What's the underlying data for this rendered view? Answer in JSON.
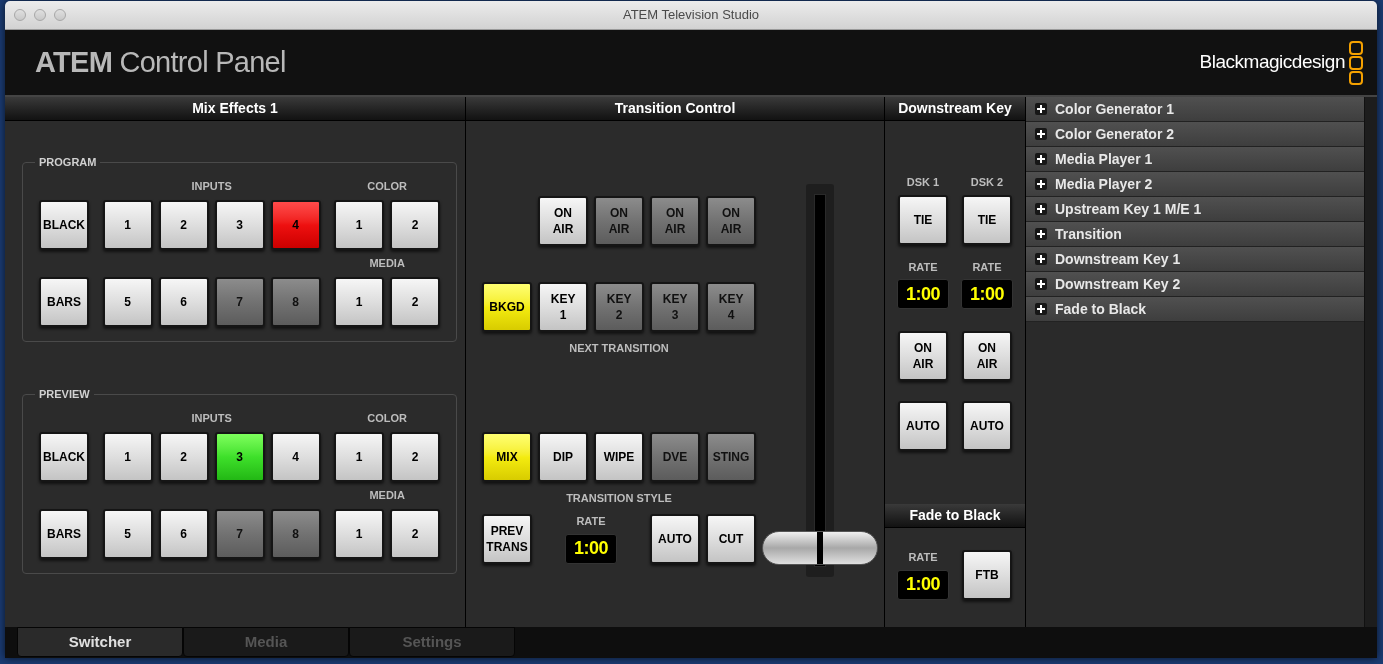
{
  "window": {
    "title": "ATEM Television Studio"
  },
  "header": {
    "title": "**ATEM** Control Panel",
    "logo": "Blackmagicdesign"
  },
  "mix_effects": {
    "title": "Mix Effects 1",
    "buses": [
      {
        "kind": "program",
        "label": "PROGRAM",
        "inputs_label": "INPUTS",
        "color_label": "COLOR",
        "media_label": "MEDIA",
        "rows": [
          {
            "special": {
              "label": "BLACK",
              "enabled": true,
              "selected": false
            },
            "inputs": [
              {
                "label": "1",
                "enabled": true,
                "selected": false
              },
              {
                "label": "2",
                "enabled": true,
                "selected": false
              },
              {
                "label": "3",
                "enabled": true,
                "selected": false
              },
              {
                "label": "4",
                "enabled": true,
                "selected": true
              }
            ],
            "extras": [
              {
                "label": "1",
                "enabled": true,
                "selected": false
              },
              {
                "label": "2",
                "enabled": true,
                "selected": false
              }
            ]
          },
          {
            "special": {
              "label": "BARS",
              "enabled": true,
              "selected": false
            },
            "inputs": [
              {
                "label": "5",
                "enabled": true,
                "selected": false
              },
              {
                "label": "6",
                "enabled": true,
                "selected": false
              },
              {
                "label": "7",
                "enabled": false,
                "selected": false
              },
              {
                "label": "8",
                "enabled": false,
                "selected": false
              }
            ],
            "extras": [
              {
                "label": "1",
                "enabled": true,
                "selected": false
              },
              {
                "label": "2",
                "enabled": true,
                "selected": false
              }
            ]
          }
        ]
      },
      {
        "kind": "preview",
        "label": "PREVIEW",
        "inputs_label": "INPUTS",
        "color_label": "COLOR",
        "media_label": "MEDIA",
        "rows": [
          {
            "special": {
              "label": "BLACK",
              "enabled": true,
              "selected": false
            },
            "inputs": [
              {
                "label": "1",
                "enabled": true,
                "selected": false
              },
              {
                "label": "2",
                "enabled": true,
                "selected": false
              },
              {
                "label": "3",
                "enabled": true,
                "selected": true
              },
              {
                "label": "4",
                "enabled": true,
                "selected": false
              }
            ],
            "extras": [
              {
                "label": "1",
                "enabled": true,
                "selected": false
              },
              {
                "label": "2",
                "enabled": true,
                "selected": false
              }
            ]
          },
          {
            "special": {
              "label": "BARS",
              "enabled": true,
              "selected": false
            },
            "inputs": [
              {
                "label": "5",
                "enabled": true,
                "selected": false
              },
              {
                "label": "6",
                "enabled": true,
                "selected": false
              },
              {
                "label": "7",
                "enabled": false,
                "selected": false
              },
              {
                "label": "8",
                "enabled": false,
                "selected": false
              }
            ],
            "extras": [
              {
                "label": "1",
                "enabled": true,
                "selected": false
              },
              {
                "label": "2",
                "enabled": true,
                "selected": false
              }
            ]
          }
        ]
      }
    ]
  },
  "transition_control": {
    "title": "Transition Control",
    "on_air": [
      {
        "label": "ON AIR",
        "enabled": true,
        "selected": false
      },
      {
        "label": "ON AIR",
        "enabled": false,
        "selected": false
      },
      {
        "label": "ON AIR",
        "enabled": false,
        "selected": false
      },
      {
        "label": "ON AIR",
        "enabled": false,
        "selected": false
      }
    ],
    "next_transition": [
      {
        "label": "BKGD",
        "enabled": true,
        "selected": true
      },
      {
        "label": "KEY 1",
        "enabled": true,
        "selected": false
      },
      {
        "label": "KEY 2",
        "enabled": false,
        "selected": false
      },
      {
        "label": "KEY 3",
        "enabled": false,
        "selected": false
      },
      {
        "label": "KEY 4",
        "enabled": false,
        "selected": false
      }
    ],
    "next_transition_label": "NEXT TRANSITION",
    "styles": [
      {
        "label": "MIX",
        "enabled": true,
        "selected": true
      },
      {
        "label": "DIP",
        "enabled": true,
        "selected": false
      },
      {
        "label": "WIPE",
        "enabled": true,
        "selected": false
      },
      {
        "label": "DVE",
        "enabled": false,
        "selected": false
      },
      {
        "label": "STING",
        "enabled": false,
        "selected": false
      }
    ],
    "style_label": "TRANSITION STYLE",
    "prev_trans": {
      "label": "PREV TRANS",
      "enabled": true,
      "selected": false
    },
    "rate": {
      "label": "RATE",
      "value": "1:00"
    },
    "auto": {
      "label": "AUTO",
      "enabled": true,
      "selected": false
    },
    "cut": {
      "label": "CUT",
      "enabled": true,
      "selected": false
    }
  },
  "downstream_key": {
    "title": "Downstream Key",
    "keys": [
      {
        "label": "DSK 1",
        "tie": {
          "label": "TIE",
          "enabled": true,
          "selected": false
        },
        "rate": {
          "label": "RATE",
          "value": "1:00"
        },
        "on_air": {
          "label": "ON AIR",
          "enabled": true,
          "selected": false
        },
        "auto": {
          "label": "AUTO",
          "enabled": true,
          "selected": false
        }
      },
      {
        "label": "DSK 2",
        "tie": {
          "label": "TIE",
          "enabled": true,
          "selected": false
        },
        "rate": {
          "label": "RATE",
          "value": "1:00"
        },
        "on_air": {
          "label": "ON AIR",
          "enabled": true,
          "selected": false
        },
        "auto": {
          "label": "AUTO",
          "enabled": true,
          "selected": false
        }
      }
    ]
  },
  "fade_to_black": {
    "title": "Fade to Black",
    "rate": {
      "label": "RATE",
      "value": "1:00"
    },
    "button": {
      "label": "FTB",
      "enabled": true,
      "selected": false
    }
  },
  "settings_panel": {
    "items": [
      {
        "label": "Color Generator 1",
        "expanded": false
      },
      {
        "label": "Color Generator 2",
        "expanded": false
      },
      {
        "label": "Media Player 1",
        "expanded": false
      },
      {
        "label": "Media Player 2",
        "expanded": false
      },
      {
        "label": "Upstream Key 1 M/E 1",
        "expanded": false
      },
      {
        "label": "Transition",
        "expanded": false
      },
      {
        "label": "Downstream Key 1",
        "expanded": false
      },
      {
        "label": "Downstream Key 2",
        "expanded": false
      },
      {
        "label": "Fade to Black",
        "expanded": false
      }
    ]
  },
  "tabs": [
    {
      "label": "Switcher",
      "selected": true
    },
    {
      "label": "Media",
      "selected": false
    },
    {
      "label": "Settings",
      "selected": false
    }
  ]
}
